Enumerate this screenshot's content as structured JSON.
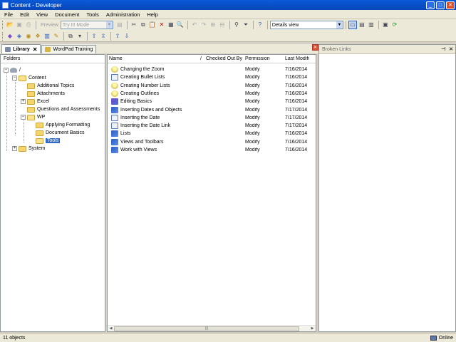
{
  "window": {
    "title": "Content - Developer"
  },
  "menu": [
    "File",
    "Edit",
    "View",
    "Document",
    "Tools",
    "Administration",
    "Help"
  ],
  "toolbar": {
    "preview_label": "Preview",
    "mode_value": "Try It! Mode",
    "view_value": "Details view"
  },
  "tabs": [
    {
      "label": "Library",
      "close": "✕"
    },
    {
      "label": "WordPad Training"
    }
  ],
  "folders": {
    "header": "Folders",
    "items": [
      {
        "label": "/"
      },
      {
        "label": "Content"
      },
      {
        "label": "Additional Topics"
      },
      {
        "label": "Attachments"
      },
      {
        "label": "Excel"
      },
      {
        "label": "Questions and Assessments"
      },
      {
        "label": "WP"
      },
      {
        "label": "Applying Formatting"
      },
      {
        "label": "Document Basics"
      },
      {
        "label": "Tools"
      },
      {
        "label": "System"
      }
    ]
  },
  "list": {
    "columns": [
      "Name",
      "Checked Out By",
      "Permission",
      "Last Modifi"
    ],
    "rows": [
      {
        "icon": "bulb-icon",
        "name": "Changing the Zoom",
        "checked_out": "",
        "permission": "Modify",
        "modified": "7/16/2014"
      },
      {
        "icon": "page-icon",
        "name": "Creating Bullet Lists",
        "checked_out": "",
        "permission": "Modify",
        "modified": "7/16/2014"
      },
      {
        "icon": "bulb-icon",
        "name": "Creating Number Lists",
        "checked_out": "",
        "permission": "Modify",
        "modified": "7/16/2014"
      },
      {
        "icon": "bulb-icon",
        "name": "Creating Outlines",
        "checked_out": "",
        "permission": "Modify",
        "modified": "7/16/2014"
      },
      {
        "icon": "edit-icon",
        "name": "Editing Basics",
        "checked_out": "",
        "permission": "Modify",
        "modified": "7/16/2014"
      },
      {
        "icon": "book-icon",
        "name": "Inserting Dates and Objects",
        "checked_out": "",
        "permission": "Modify",
        "modified": "7/17/2014"
      },
      {
        "icon": "page-icon",
        "name": "Inserting the Date",
        "checked_out": "",
        "permission": "Modify",
        "modified": "7/17/2014"
      },
      {
        "icon": "page-icon",
        "name": "Inserting the Date Link",
        "checked_out": "",
        "permission": "Modify",
        "modified": "7/17/2014"
      },
      {
        "icon": "book-icon",
        "name": "Lists",
        "checked_out": "",
        "permission": "Modify",
        "modified": "7/16/2014"
      },
      {
        "icon": "book-icon",
        "name": "Views and Toolbars",
        "checked_out": "",
        "permission": "Modify",
        "modified": "7/16/2014"
      },
      {
        "icon": "book-icon",
        "name": "Work with Views",
        "checked_out": "",
        "permission": "Modify",
        "modified": "7/16/2014"
      }
    ]
  },
  "broken_links": {
    "title": "Broken Links"
  },
  "status": {
    "count": "11 objects",
    "connection": "Online"
  }
}
